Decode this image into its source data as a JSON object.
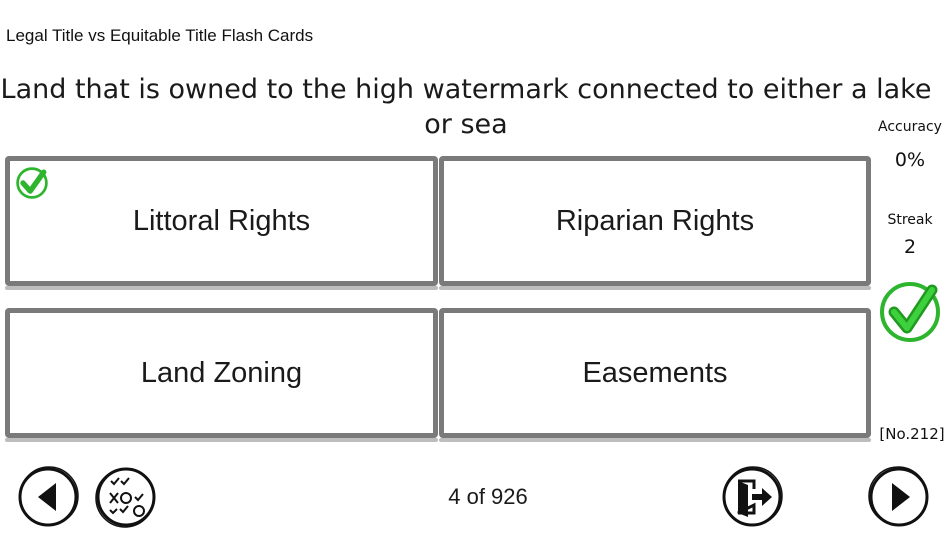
{
  "deck": {
    "title": "Legal Title vs Equitable Title Flash Cards"
  },
  "question": {
    "text": "Land that is owned to the high watermark connected to either a lake or sea"
  },
  "answers": [
    {
      "label": "Littoral Rights",
      "marked_correct": true
    },
    {
      "label": "Riparian Rights",
      "marked_correct": false
    },
    {
      "label": "Land Zoning",
      "marked_correct": false
    },
    {
      "label": "Easements",
      "marked_correct": false
    }
  ],
  "stats": {
    "accuracy_label": "Accuracy",
    "accuracy_value": "0%",
    "streak_label": "Streak",
    "streak_value": "2",
    "card_number": "[No.212]"
  },
  "navigation": {
    "counter": "4 of 926"
  },
  "colors": {
    "correct_green": "#2db52d",
    "card_border": "#7a7a7a"
  },
  "icons": [
    "check-icon",
    "prev-arrow-icon",
    "quiz-mode-icon",
    "exit-icon",
    "next-arrow-icon"
  ]
}
